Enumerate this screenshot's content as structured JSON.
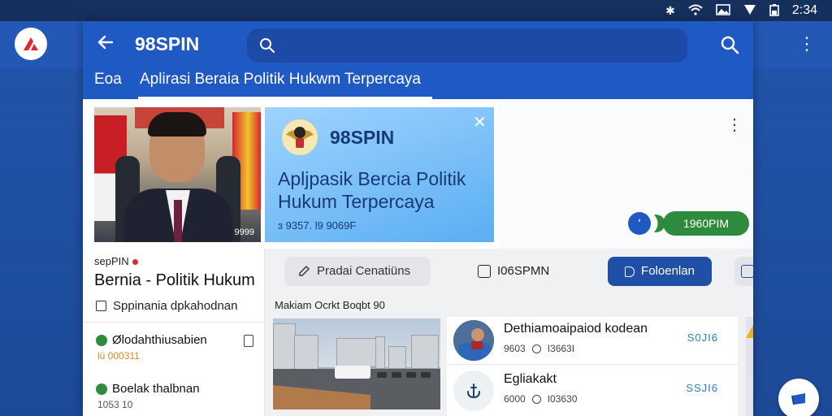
{
  "status_bar": {
    "time": "2:34",
    "icons": [
      "bluetooth-icon",
      "wifi-icon",
      "image-icon",
      "signal-icon",
      "battery-icon"
    ]
  },
  "colors": {
    "app_header": "#1f59c4",
    "backdrop": "#2358b5",
    "accent_green": "#2e8b3e",
    "accent_blue_button": "#1f4fa6",
    "count_blue": "#2a7fb8"
  },
  "header": {
    "back_icon": "arrow-left-icon",
    "title": "98SPIN",
    "search_placeholder": "",
    "search_value": ""
  },
  "tabs": [
    {
      "label": "Eoa"
    },
    {
      "label": "Aplirasi Beraia Politik Hukwm Terpercaya",
      "active": true
    }
  ],
  "photo_card": {
    "caption": "9999"
  },
  "promo_card": {
    "brand": "98SPIN",
    "headline": "Apljpasik Bercia Politik Hukum Terpercaya",
    "subline": "ɜ 9357. l9 9069F"
  },
  "right_panel": {
    "pill_label": "1960PIM"
  },
  "left_column": {
    "tag": "sepPIN",
    "title": "Bernia - Politik Hukum",
    "check_label": "Sppinania dpkahodnan",
    "items": [
      {
        "title": "Ølodahthiusabien",
        "sub": "lü 000311"
      },
      {
        "title": "Boelak thalbnan",
        "sub": "1053 10"
      }
    ]
  },
  "chips": {
    "chip1": "Pradai Cenatiüns",
    "chip2": "I06SPMN",
    "chip3": "Foloenlan"
  },
  "mid_section": {
    "label": "Makiam Ocrkt  Boqbt 90"
  },
  "news_list": [
    {
      "title": "Dethiamoaipaiod kodean",
      "meta1": "9603",
      "meta2": "I3663I",
      "count": "S0JI6"
    },
    {
      "title": "Egliakakt",
      "meta1": "6000",
      "meta2": "I03630",
      "count": "SSJI6"
    }
  ]
}
